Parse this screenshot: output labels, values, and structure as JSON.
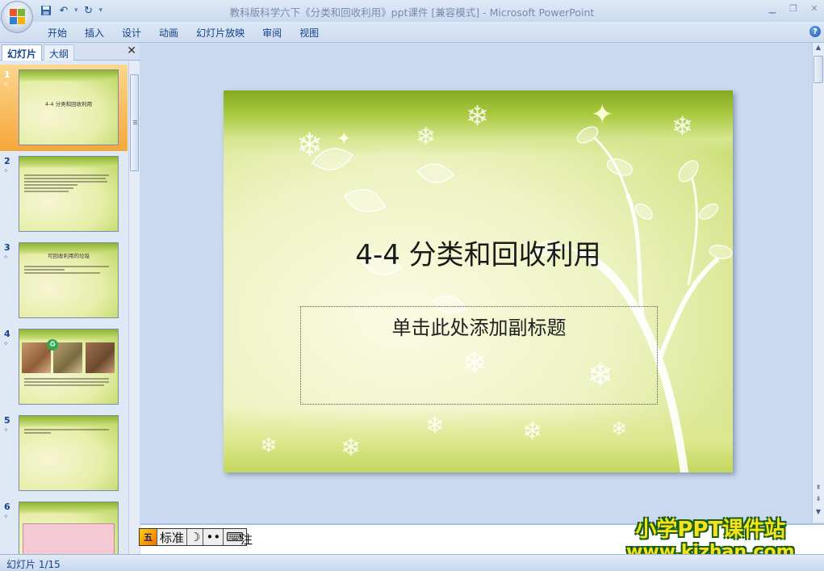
{
  "window": {
    "title": "教科版科学六下《分类和回收利用》ppt课件 [兼容模式] - Microsoft PowerPoint"
  },
  "ribbon": {
    "tabs": [
      "开始",
      "插入",
      "设计",
      "动画",
      "幻灯片放映",
      "审阅",
      "视图"
    ]
  },
  "slide_pane": {
    "tab_slides": "幻灯片",
    "tab_outline": "大纲",
    "thumbnails": [
      {
        "number": "1",
        "title": "4-4 分类和回收利用"
      },
      {
        "number": "2"
      },
      {
        "number": "3",
        "title": "可回收利用的垃圾"
      },
      {
        "number": "4"
      },
      {
        "number": "5"
      },
      {
        "number": "6"
      }
    ]
  },
  "slide": {
    "title": "4-4 分类和回收利用",
    "subtitle_placeholder": "单击此处添加副标题"
  },
  "notes": {
    "label": "注"
  },
  "ime": {
    "mode": "标准"
  },
  "watermark": {
    "line1": "小学PPT课件站",
    "line2": "www.kjzhan.com"
  },
  "status": {
    "slide_indicator": "幻灯片 1/15"
  }
}
